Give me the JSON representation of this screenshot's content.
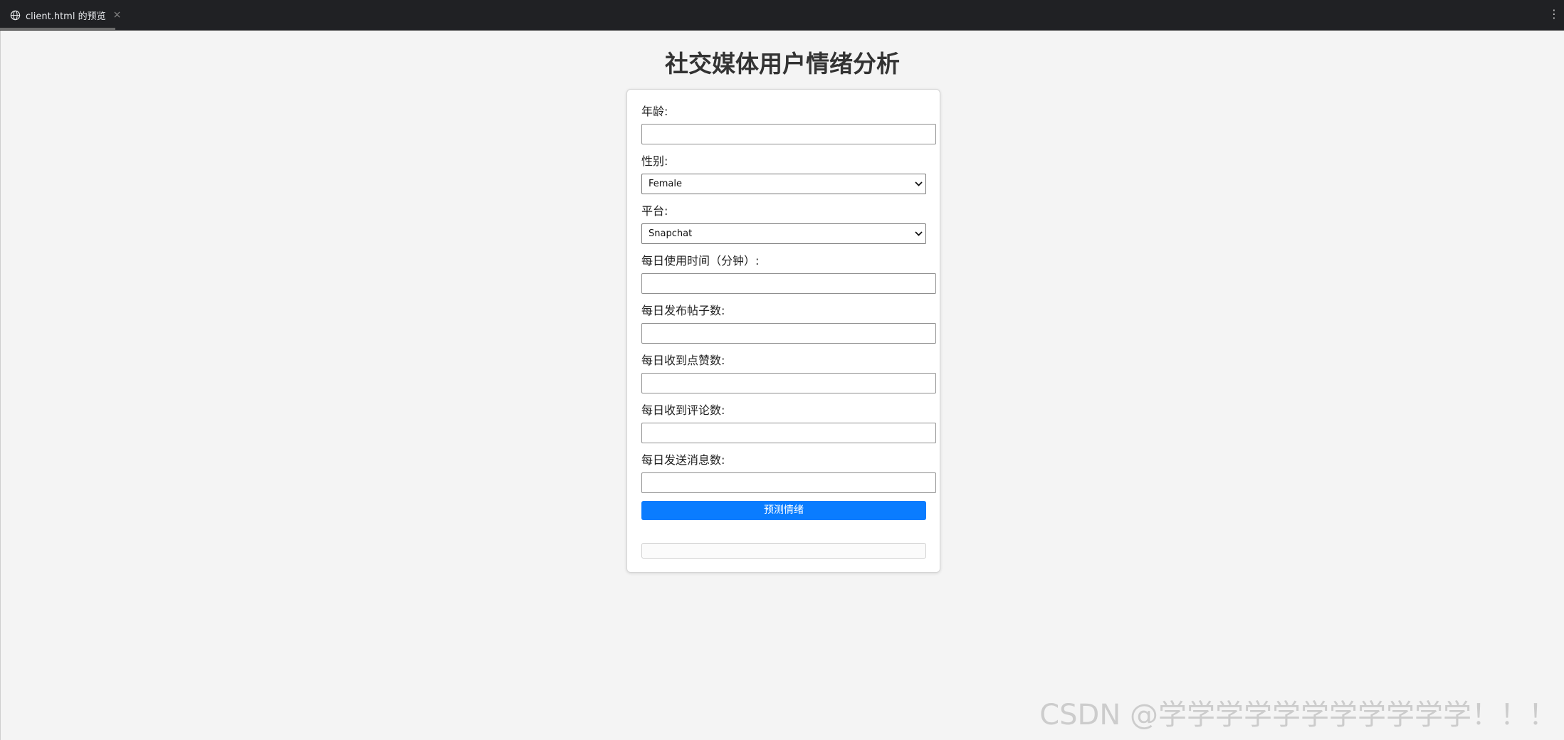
{
  "browser": {
    "tab_title": "client.html 的预览",
    "tab_close": "×",
    "menu_glyph": "⋮"
  },
  "page": {
    "title": "社交媒体用户情绪分析"
  },
  "form": {
    "age_label": "年龄:",
    "age_value": "",
    "gender_label": "性别:",
    "gender_selected": "Female",
    "platform_label": "平台:",
    "platform_selected": "Snapchat",
    "daily_usage_label": "每日使用时间（分钟）:",
    "daily_usage_value": "",
    "posts_label": "每日发布帖子数:",
    "posts_value": "",
    "likes_label": "每日收到点赞数:",
    "likes_value": "",
    "comments_label": "每日收到评论数:",
    "comments_value": "",
    "messages_label": "每日发送消息数:",
    "messages_value": "",
    "submit_label": "预测情绪",
    "result_text": ""
  },
  "watermark": "CSDN @学学学学学学学学学学学！！！",
  "colors": {
    "accent": "#0a7cff",
    "tabbar": "#202124",
    "page_bg": "#f4f4f4"
  }
}
